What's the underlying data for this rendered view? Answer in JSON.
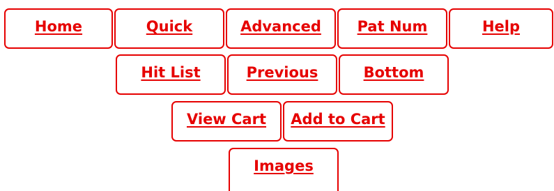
{
  "nav": {
    "row1": [
      {
        "id": "home",
        "label": "Home"
      },
      {
        "id": "quick",
        "label": "Quick"
      },
      {
        "id": "advanced",
        "label": "Advanced"
      },
      {
        "id": "pat-num",
        "label": "Pat Num"
      },
      {
        "id": "help",
        "label": "Help"
      }
    ],
    "row2": [
      {
        "id": "hit-list",
        "label": "Hit List"
      },
      {
        "id": "previous",
        "label": "Previous"
      },
      {
        "id": "bottom",
        "label": "Bottom"
      }
    ],
    "row3": [
      {
        "id": "view-cart",
        "label": "View Cart"
      },
      {
        "id": "add-to-cart",
        "label": "Add to Cart"
      }
    ],
    "row4": [
      {
        "id": "images",
        "label": "Images"
      }
    ]
  },
  "colors": {
    "accent": "#e60000",
    "background": "#ffffff"
  }
}
